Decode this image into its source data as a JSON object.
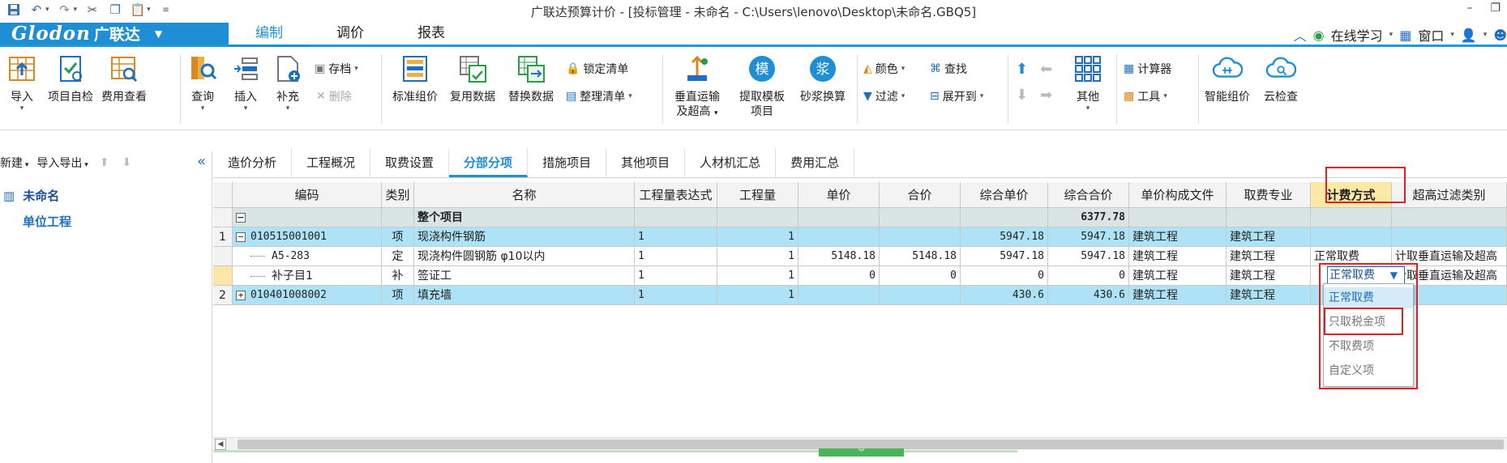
{
  "window": {
    "title": "广联达预算计价 - [投标管理 - 未命名 - C:\\Users\\lenovo\\Desktop\\未命名.GBQ5]"
  },
  "menu": {
    "brand": "Glodon",
    "brand_cn": "广联达",
    "tabs": [
      "编制",
      "调价",
      "报表"
    ],
    "online_learning": "在线学习",
    "window_label": "窗口"
  },
  "ribbon": {
    "import": "导入",
    "self_check": "项目自检",
    "fee_view": "费用查看",
    "query": "查询",
    "insert": "插入",
    "supplement": "补充",
    "save_as": "存档",
    "delete": "删除",
    "standard_pricing": "标准组价",
    "reuse_data": "复用数据",
    "replace_data": "替换数据",
    "lock_list": "锁定清单",
    "organize_list": "整理清单",
    "vertical_transport_1": "垂直运输",
    "vertical_transport_2": "及超高",
    "extract_template_1": "提取模板",
    "extract_template_2": "项目",
    "mortar_convert": "砂浆换算",
    "color": "颜色",
    "find": "查找",
    "filter": "过滤",
    "expand_to": "展开到",
    "other": "其他",
    "calculator": "计算器",
    "tools": "工具",
    "smart_pricing": "智能组价",
    "cloud_check": "云检查",
    "mold_glyph": "模",
    "mortar_glyph": "浆"
  },
  "left_panel": {
    "new": "新建",
    "import_export": "导入导出",
    "root": "未命名",
    "child": "单位工程"
  },
  "content_tabs": [
    "造价分析",
    "工程概况",
    "取费设置",
    "分部分项",
    "措施项目",
    "其他项目",
    "人材机汇总",
    "费用汇总"
  ],
  "grid": {
    "headers": [
      "编码",
      "类别",
      "名称",
      "工程量表达式",
      "工程量",
      "单价",
      "合价",
      "综合单价",
      "综合合价",
      "单价构成文件",
      "取费专业",
      "计费方式",
      "超高过滤类别"
    ],
    "total_row": {
      "name": "整个项目",
      "total": "6377.78"
    },
    "rows": [
      {
        "no": "1",
        "code": "010515001001",
        "type": "项",
        "name": "现浇构件钢筋",
        "expr": "1",
        "qty": "1",
        "unit": "",
        "sum": "",
        "cunit": "5947.18",
        "csum": "5947.18",
        "file": "建筑工程",
        "major": "建筑工程",
        "mode": "",
        "filter": ""
      },
      {
        "no": "",
        "code": "A5-283",
        "type": "定",
        "name": "现浇构件圆钢筋 φ10以内",
        "expr": "1",
        "qty": "1",
        "unit": "5148.18",
        "sum": "5148.18",
        "cunit": "5947.18",
        "csum": "5947.18",
        "file": "建筑工程",
        "major": "建筑工程",
        "mode": "正常取费",
        "filter": "计取垂直运输及超高"
      },
      {
        "no": "",
        "code": "补子目1",
        "type": "补",
        "name": "签证工",
        "expr": "1",
        "qty": "1",
        "unit": "0",
        "sum": "0",
        "cunit": "0",
        "csum": "0",
        "file": "建筑工程",
        "major": "建筑工程",
        "mode": "正常取费",
        "filter": "计取垂直运输及超高"
      },
      {
        "no": "2",
        "code": "010401008002",
        "type": "项",
        "name": "填充墙",
        "expr": "1",
        "qty": "1",
        "unit": "",
        "sum": "",
        "cunit": "430.6",
        "csum": "430.6",
        "file": "建筑工程",
        "major": "建筑工程",
        "mode": "",
        "filter": ""
      }
    ]
  },
  "dropdown": {
    "value": "正常取费",
    "options": [
      "正常取费",
      "只取税金项",
      "不取费项",
      "自定义项"
    ]
  },
  "colors": {
    "accent": "#1e8fd4",
    "row_blue": "#aee3f7",
    "highlight": "#e02020"
  }
}
